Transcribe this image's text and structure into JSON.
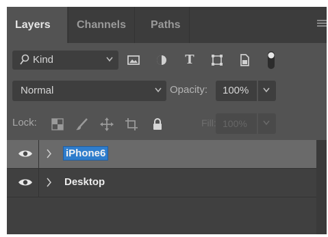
{
  "panel": {
    "tabs": [
      {
        "label": "Layers",
        "active": true
      },
      {
        "label": "Channels",
        "active": false
      },
      {
        "label": "Paths",
        "active": false
      }
    ],
    "menu_icon": "hamburger-icon"
  },
  "filter": {
    "kind_label": "Kind",
    "icons": [
      "search-icon",
      "image-filter-icon",
      "adjustment-filter-icon",
      "type-filter-icon",
      "shape-filter-icon",
      "smart-object-filter-icon",
      "filter-toggle-icon"
    ]
  },
  "blend": {
    "mode": "Normal",
    "opacity_label": "Opacity:",
    "opacity_value": "100%"
  },
  "lock": {
    "label": "Lock:",
    "icons": [
      "lock-transparent-icon",
      "lock-paint-icon",
      "lock-move-icon",
      "lock-artboard-icon",
      "lock-all-icon"
    ],
    "fill_label": "Fill:",
    "fill_value": "100%"
  },
  "layers": [
    {
      "name": "iPhone6",
      "selected": true,
      "visible": true,
      "type": "group"
    },
    {
      "name": "Desktop",
      "selected": false,
      "visible": true,
      "type": "group"
    }
  ],
  "colors": {
    "panel": "#535353",
    "tab_strip": "#3c3c3c",
    "layer_list": "#404040",
    "selected_row": "#6a6a6a",
    "selection_highlight": "#2f7dcc"
  }
}
